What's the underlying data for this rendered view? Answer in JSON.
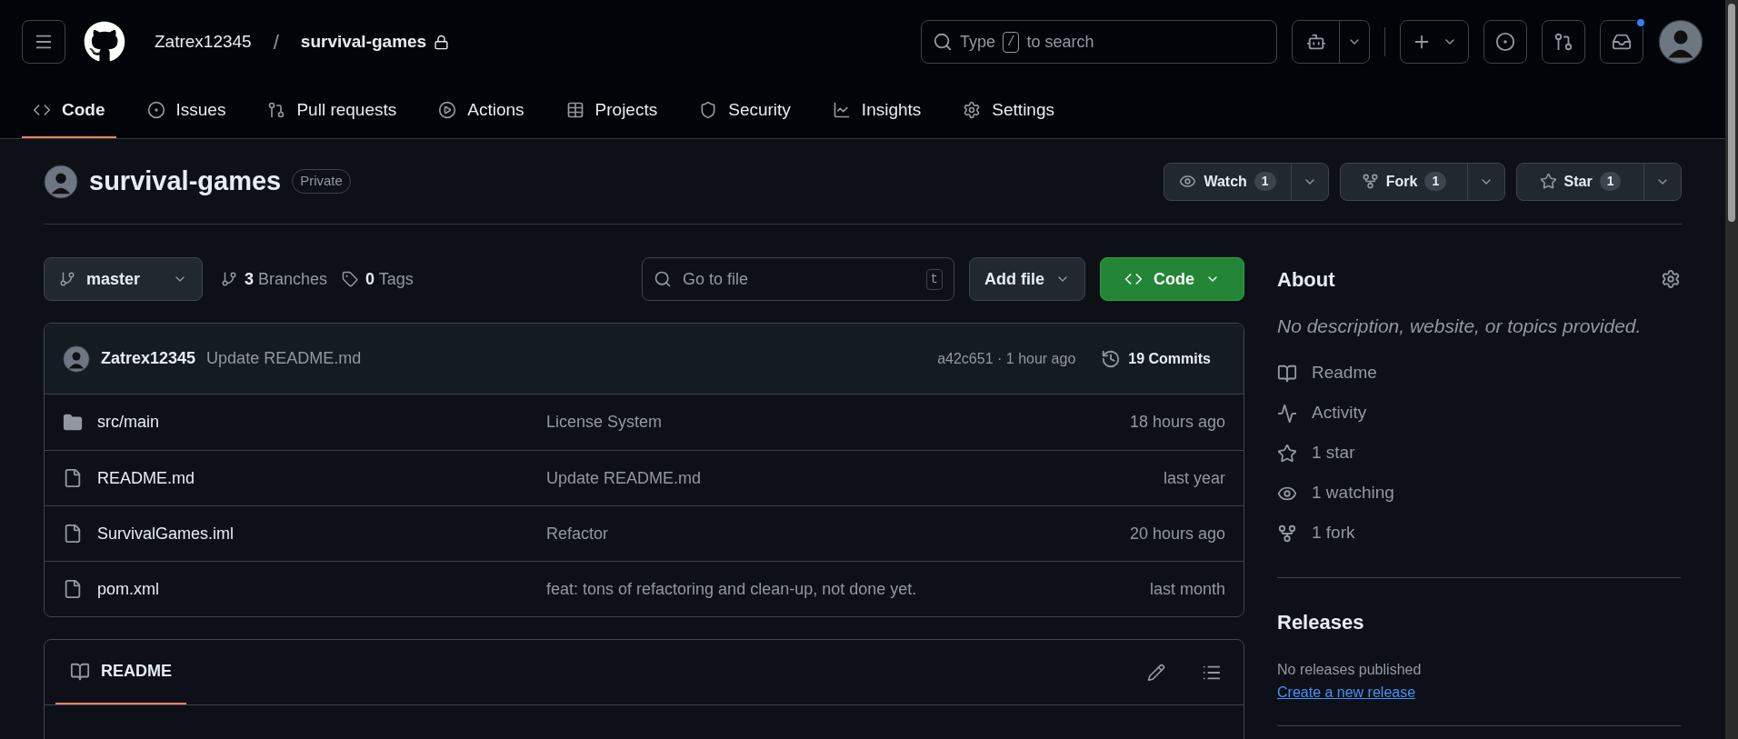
{
  "topbar": {
    "owner": "Zatrex12345",
    "separator": "/",
    "repo": "survival-games",
    "search": {
      "before": "Type",
      "key": "/",
      "after": "to search"
    },
    "notifications": {
      "unread": true
    }
  },
  "tabs": [
    {
      "label": "Code",
      "kind": "code",
      "selected": true
    },
    {
      "label": "Issues",
      "kind": "issues",
      "selected": false
    },
    {
      "label": "Pull requests",
      "kind": "pulls",
      "selected": false
    },
    {
      "label": "Actions",
      "kind": "actions",
      "selected": false
    },
    {
      "label": "Projects",
      "kind": "projects",
      "selected": false
    },
    {
      "label": "Security",
      "kind": "security",
      "selected": false
    },
    {
      "label": "Insights",
      "kind": "insights",
      "selected": false
    },
    {
      "label": "Settings",
      "kind": "settings",
      "selected": false
    }
  ],
  "repo_header": {
    "name": "survival-games",
    "visibility": "Private",
    "actions": [
      {
        "label": "Watch",
        "count": "1",
        "kind": "eye"
      },
      {
        "label": "Fork",
        "count": "1",
        "kind": "fork"
      },
      {
        "label": "Star",
        "count": "1",
        "kind": "star"
      }
    ]
  },
  "toolbar": {
    "branch": "master",
    "branches_count": "3",
    "branches_label": "Branches",
    "tags_count": "0",
    "tags_label": "Tags",
    "file_search": {
      "placeholder": "Go to file",
      "key": "t"
    },
    "add_file": "Add file",
    "code": "Code"
  },
  "last_commit": {
    "author": "Zatrex12345",
    "message": "Update README.md",
    "hash_time": "a42c651 · 1 hour ago",
    "commits": "19 Commits"
  },
  "files": [
    {
      "kind": "folder",
      "name": "src/main",
      "message": "License System",
      "time": "18 hours ago"
    },
    {
      "kind": "file",
      "name": "README.md",
      "message": "Update README.md",
      "time": "last year"
    },
    {
      "kind": "file",
      "name": "SurvivalGames.iml",
      "message": "Refactor",
      "time": "20 hours ago"
    },
    {
      "kind": "file",
      "name": "pom.xml",
      "message": "feat: tons of refactoring and clean-up, not done yet.",
      "time": "last month"
    }
  ],
  "readme": {
    "tab": "README"
  },
  "sidebar": {
    "about_title": "About",
    "description": "No description, website, or topics provided.",
    "links": [
      {
        "kind": "book",
        "label": "Readme"
      },
      {
        "kind": "activity",
        "label": "Activity"
      },
      {
        "kind": "star",
        "label": "1 star"
      },
      {
        "kind": "eye",
        "label": "1 watching"
      },
      {
        "kind": "fork",
        "label": "1 fork"
      }
    ],
    "releases_title": "Releases",
    "releases_text": "No releases published",
    "releases_link": "Create a new release"
  }
}
